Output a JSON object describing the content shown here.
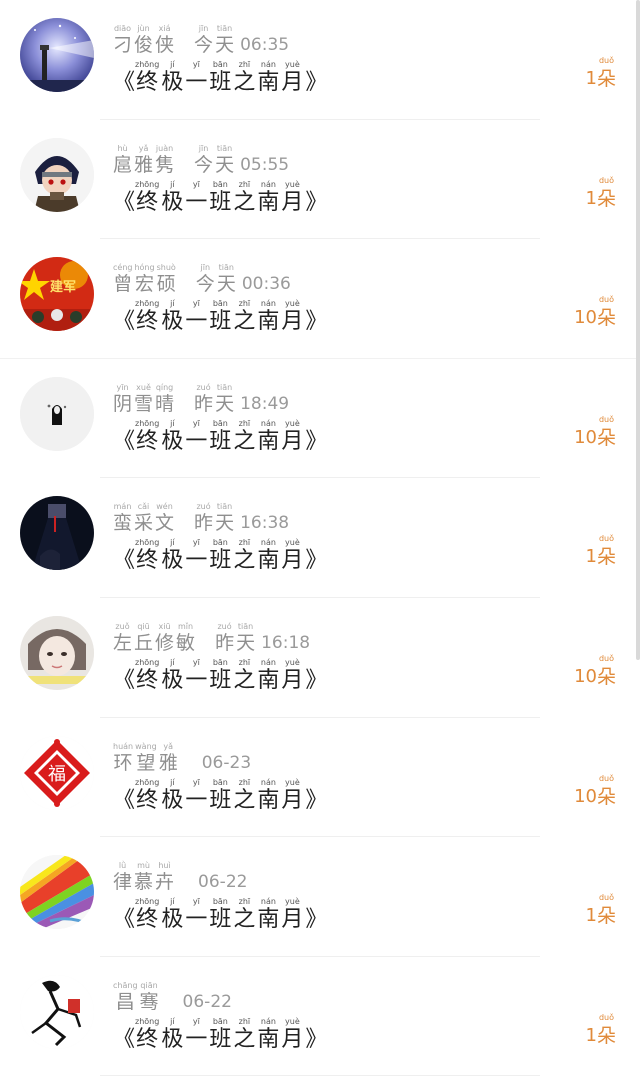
{
  "work_title": {
    "open_bracket": "《",
    "close_bracket": "》",
    "chars": [
      {
        "py": "zhōng",
        "hz": "终"
      },
      {
        "py": "jí",
        "hz": "极"
      },
      {
        "py": "yī",
        "hz": "一"
      },
      {
        "py": "bān",
        "hz": "班"
      },
      {
        "py": "zhī",
        "hz": "之"
      },
      {
        "py": "nán",
        "hz": "南"
      },
      {
        "py": "yuè",
        "hz": "月"
      }
    ]
  },
  "unit": {
    "py": "duǒ",
    "hz": "朵"
  },
  "rows": [
    {
      "name": [
        {
          "py": "diāo",
          "hz": "刁"
        },
        {
          "py": "jùn",
          "hz": "俊"
        },
        {
          "py": "xiá",
          "hz": "侠"
        }
      ],
      "day": [
        {
          "py": "jīn",
          "hz": "今"
        },
        {
          "py": "tiān",
          "hz": "天"
        }
      ],
      "time": "06:35",
      "count": "1",
      "avatar": "galaxy-lighthouse"
    },
    {
      "name": [
        {
          "py": "hù",
          "hz": "扈"
        },
        {
          "py": "yǎ",
          "hz": "雅"
        },
        {
          "py": "juàn",
          "hz": "隽"
        }
      ],
      "day": [
        {
          "py": "jīn",
          "hz": "今"
        },
        {
          "py": "tiān",
          "hz": "天"
        }
      ],
      "time": "05:55",
      "count": "1",
      "avatar": "anime-ninja"
    },
    {
      "name": [
        {
          "py": "céng",
          "hz": "曾"
        },
        {
          "py": "hóng",
          "hz": "宏"
        },
        {
          "py": "shuò",
          "hz": "硕"
        }
      ],
      "day": [
        {
          "py": "jīn",
          "hz": "今"
        },
        {
          "py": "tiān",
          "hz": "天"
        }
      ],
      "time": "00:36",
      "count": "10",
      "avatar": "army-day-poster"
    },
    {
      "name": [
        {
          "py": "yīn",
          "hz": "阴"
        },
        {
          "py": "xuě",
          "hz": "雪"
        },
        {
          "py": "qíng",
          "hz": "晴"
        }
      ],
      "day": [
        {
          "py": "zuó",
          "hz": "昨"
        },
        {
          "py": "tiān",
          "hz": "天"
        }
      ],
      "time": "18:49",
      "count": "10",
      "avatar": "no-face-spirit"
    },
    {
      "name": [
        {
          "py": "mán",
          "hz": "蛮"
        },
        {
          "py": "cǎi",
          "hz": "采"
        },
        {
          "py": "wén",
          "hz": "文"
        }
      ],
      "day": [
        {
          "py": "zuó",
          "hz": "昨"
        },
        {
          "py": "tiān",
          "hz": "天"
        }
      ],
      "time": "16:38",
      "count": "1",
      "avatar": "dark-room"
    },
    {
      "name": [
        {
          "py": "zuǒ",
          "hz": "左"
        },
        {
          "py": "qiū",
          "hz": "丘"
        },
        {
          "py": "xiū",
          "hz": "修"
        },
        {
          "py": "mǐn",
          "hz": "敏"
        }
      ],
      "day": [
        {
          "py": "zuó",
          "hz": "昨"
        },
        {
          "py": "tiān",
          "hz": "天"
        }
      ],
      "time": "16:18",
      "count": "10",
      "avatar": "girl-portrait"
    },
    {
      "name": [
        {
          "py": "huán",
          "hz": "环"
        },
        {
          "py": "wàng",
          "hz": "望"
        },
        {
          "py": "yǎ",
          "hz": "雅"
        }
      ],
      "day": [],
      "time": "06-23",
      "count": "10",
      "avatar": "fu-papercut"
    },
    {
      "name": [
        {
          "py": "lǜ",
          "hz": "律"
        },
        {
          "py": "mù",
          "hz": "慕"
        },
        {
          "py": "huì",
          "hz": "卉"
        }
      ],
      "day": [],
      "time": "06-22",
      "count": "1",
      "avatar": "rainbow-paint"
    },
    {
      "name": [
        {
          "py": "chāng",
          "hz": "昌"
        },
        {
          "py": "qiān",
          "hz": "骞"
        }
      ],
      "day": [],
      "time": "06-22",
      "count": "1",
      "avatar": "sketch-figure"
    }
  ]
}
